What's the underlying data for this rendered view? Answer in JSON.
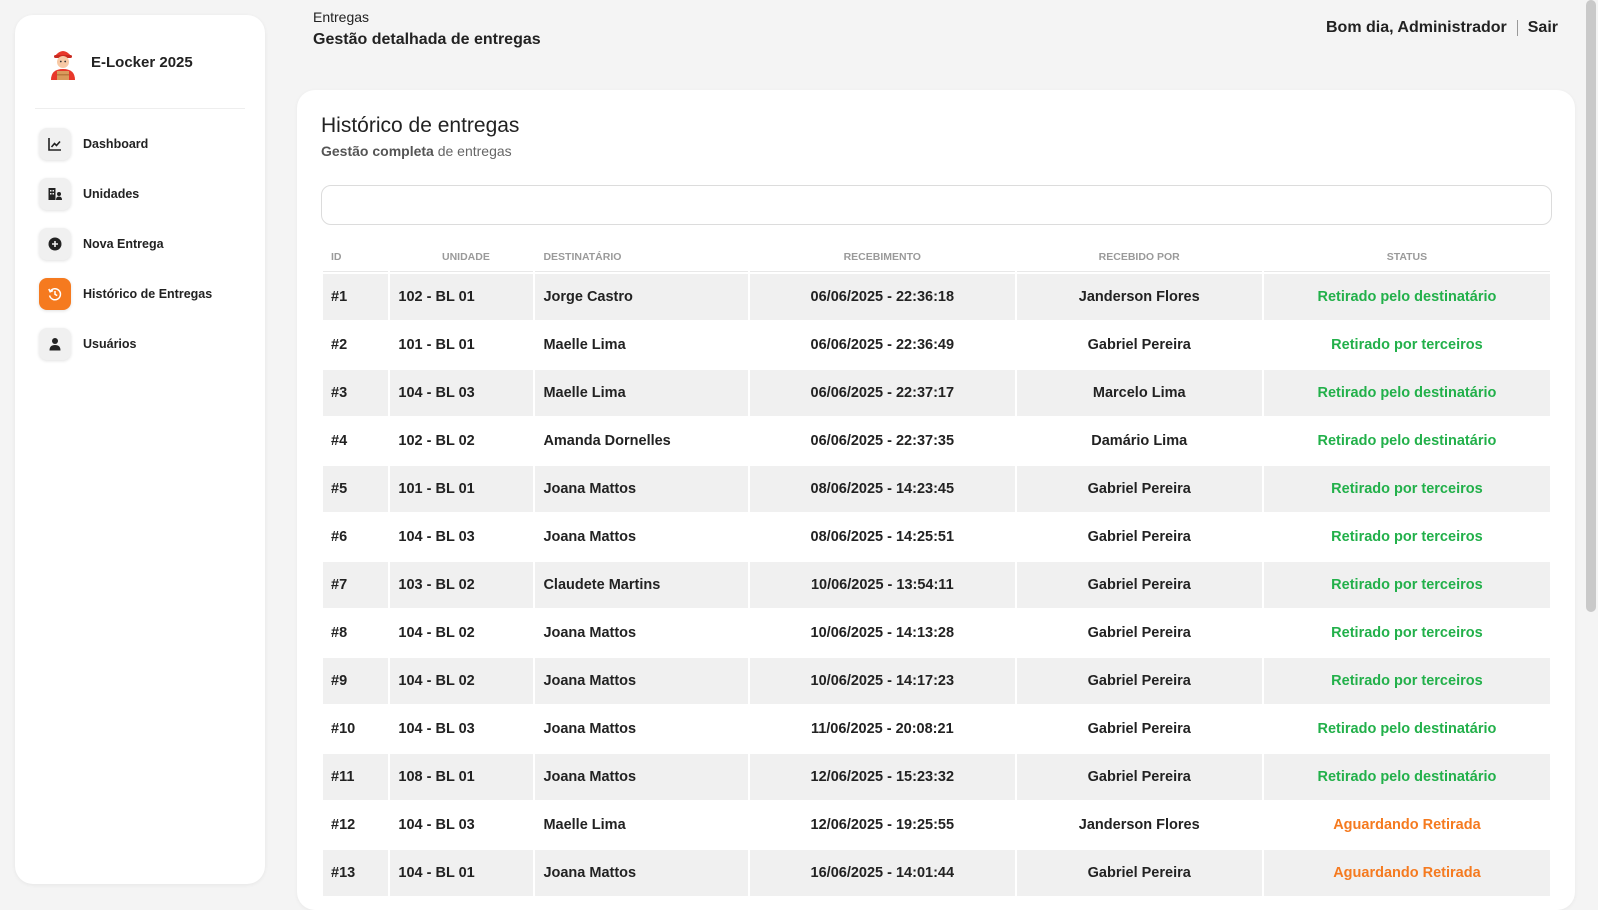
{
  "brand": {
    "name": "E-Locker 2025",
    "logo_icon": "locker-mascot-icon"
  },
  "sidebar": {
    "items": [
      {
        "label": "Dashboard",
        "icon": "chart-line-icon"
      },
      {
        "label": "Unidades",
        "icon": "building-icon"
      },
      {
        "label": "Nova Entrega",
        "icon": "plus-circle-icon"
      },
      {
        "label": "Histórico de Entregas",
        "icon": "history-icon",
        "active": true
      },
      {
        "label": "Usuários",
        "icon": "user-icon"
      }
    ]
  },
  "header": {
    "breadcrumb": "Entregas",
    "title": "Gestão detalhada de entregas",
    "greeting": "Bom dia, Administrador",
    "logout": "Sair"
  },
  "card": {
    "title": "Histórico de entregas",
    "subtitle_bold": "Gestão completa",
    "subtitle_rest": " de entregas",
    "search_value": ""
  },
  "table": {
    "headers": [
      "ID",
      "Unidade",
      "Destinatário",
      "Recebimento",
      "Recebido por",
      "Status"
    ],
    "rows": [
      [
        "#1",
        "102 - BL 01",
        "Jorge Castro",
        "06/06/2025 - 22:36:18",
        "Janderson Flores",
        "Retirado pelo destinatário"
      ],
      [
        "#2",
        "101 - BL 01",
        "Maelle Lima",
        "06/06/2025 - 22:36:49",
        "Gabriel Pereira",
        "Retirado por terceiros"
      ],
      [
        "#3",
        "104 - BL 03",
        "Maelle Lima",
        "06/06/2025 - 22:37:17",
        "Marcelo Lima",
        "Retirado pelo destinatário"
      ],
      [
        "#4",
        "102 - BL 02",
        "Amanda Dornelles",
        "06/06/2025 - 22:37:35",
        "Damário Lima",
        "Retirado pelo destinatário"
      ],
      [
        "#5",
        "101 - BL 01",
        "Joana Mattos",
        "08/06/2025 - 14:23:45",
        "Gabriel Pereira",
        "Retirado por terceiros"
      ],
      [
        "#6",
        "104 - BL 03",
        "Joana Mattos",
        "08/06/2025 - 14:25:51",
        "Gabriel Pereira",
        "Retirado por terceiros"
      ],
      [
        "#7",
        "103 - BL 02",
        "Claudete Martins",
        "10/06/2025 - 13:54:11",
        "Gabriel Pereira",
        "Retirado por terceiros"
      ],
      [
        "#8",
        "104 - BL 02",
        "Joana Mattos",
        "10/06/2025 - 14:13:28",
        "Gabriel Pereira",
        "Retirado por terceiros"
      ],
      [
        "#9",
        "104 - BL 02",
        "Joana Mattos",
        "10/06/2025 - 14:17:23",
        "Gabriel Pereira",
        "Retirado por terceiros"
      ],
      [
        "#10",
        "104 - BL 03",
        "Joana Mattos",
        "11/06/2025 - 20:08:21",
        "Gabriel Pereira",
        "Retirado pelo destinatário"
      ],
      [
        "#11",
        "108 - BL 01",
        "Joana Mattos",
        "12/06/2025 - 15:23:32",
        "Gabriel Pereira",
        "Retirado pelo destinatário"
      ],
      [
        "#12",
        "104 - BL 03",
        "Maelle Lima",
        "12/06/2025 - 19:25:55",
        "Janderson Flores",
        "Aguardando Retirada"
      ],
      [
        "#13",
        "104 - BL 01",
        "Joana Mattos",
        "16/06/2025 - 14:01:44",
        "Gabriel Pereira",
        "Aguardando Retirada"
      ]
    ]
  },
  "colors": {
    "accent": "#f57a1f",
    "status_done": "#22b04a",
    "status_pending": "#f57a1f"
  }
}
